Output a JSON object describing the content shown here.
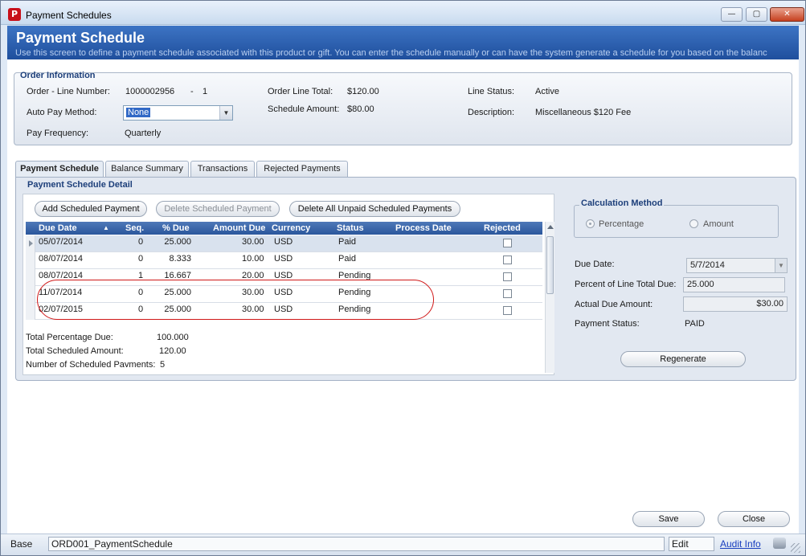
{
  "window": {
    "title": "Payment Schedules",
    "app_icon_glyph": "P",
    "controls": {
      "minimize": "—",
      "maximize": "▢",
      "close": "✕"
    }
  },
  "header": {
    "title": "Payment Schedule",
    "subtitle": "Use this screen to define a payment schedule associated with this product or gift. You can enter the schedule manually or can have the system generate a schedule for you based on the balanc"
  },
  "order_info": {
    "group_title": "Order Information",
    "order_line_label": "Order - Line Number:",
    "order_number": "1000002956",
    "dash": "-",
    "line_number": "1",
    "auto_pay_label": "Auto Pay Method:",
    "auto_pay_value": "None",
    "pay_frequency_label": "Pay Frequency:",
    "pay_frequency_value": "Quarterly",
    "order_line_total_label": "Order Line Total:",
    "order_line_total_value": "$120.00",
    "schedule_amount_label": "Schedule Amount:",
    "schedule_amount_value": "$80.00",
    "line_status_label": "Line Status:",
    "line_status_value": "Active",
    "description_label": "Description:",
    "description_value": "Miscellaneous $120 Fee"
  },
  "tabs": [
    {
      "label": "Payment Schedule",
      "active": true
    },
    {
      "label": "Balance Summary",
      "active": false
    },
    {
      "label": "Transactions",
      "active": false
    },
    {
      "label": "Rejected Payments",
      "active": false
    }
  ],
  "detail": {
    "title": "Payment Schedule Detail",
    "buttons": {
      "add": "Add Scheduled Payment",
      "delete": "Delete Scheduled Payment",
      "delete_all": "Delete All Unpaid Scheduled Payments"
    },
    "columns": [
      "Due Date",
      "Seq.",
      "% Due",
      "Amount Due",
      "Currency",
      "Status",
      "Process Date",
      "Rejected"
    ],
    "sort_indicator": "▲",
    "rows": [
      {
        "due_date": "05/07/2014",
        "seq": "0",
        "pct": "25.000",
        "amount": "30.00",
        "currency": "USD",
        "status": "Paid",
        "process_date": "",
        "selected": true
      },
      {
        "due_date": "08/07/2014",
        "seq": "0",
        "pct": "8.333",
        "amount": "10.00",
        "currency": "USD",
        "status": "Paid",
        "process_date": "",
        "selected": false
      },
      {
        "due_date": "08/07/2014",
        "seq": "1",
        "pct": "16.667",
        "amount": "20.00",
        "currency": "USD",
        "status": "Pending",
        "process_date": "",
        "selected": false
      },
      {
        "due_date": "11/07/2014",
        "seq": "0",
        "pct": "25.000",
        "amount": "30.00",
        "currency": "USD",
        "status": "Pending",
        "process_date": "",
        "selected": false
      },
      {
        "due_date": "02/07/2015",
        "seq": "0",
        "pct": "25.000",
        "amount": "30.00",
        "currency": "USD",
        "status": "Pending",
        "process_date": "",
        "selected": false
      }
    ],
    "totals": {
      "pct_label": "Total Percentage Due:",
      "pct_value": "100.000",
      "amount_label": "Total Scheduled Amount:",
      "amount_value": "120.00",
      "count_label": "Number of Scheduled Payments:",
      "count_value": "5"
    }
  },
  "calc": {
    "title": "Calculation Method",
    "percentage": "Percentage",
    "amount": "Amount",
    "due_date_label": "Due Date:",
    "due_date_value": "5/7/2014",
    "percent_label": "Percent of Line Total Due:",
    "percent_value": "25.000",
    "actual_label": "Actual Due Amount:",
    "actual_value": "$30.00",
    "status_label": "Payment Status:",
    "status_value": "PAID",
    "regenerate": "Regenerate"
  },
  "footer": {
    "save": "Save",
    "close": "Close"
  },
  "statusbar": {
    "base": "Base",
    "screen_id": "ORD001_PaymentSchedule",
    "mode": "Edit",
    "audit": "Audit Info"
  }
}
